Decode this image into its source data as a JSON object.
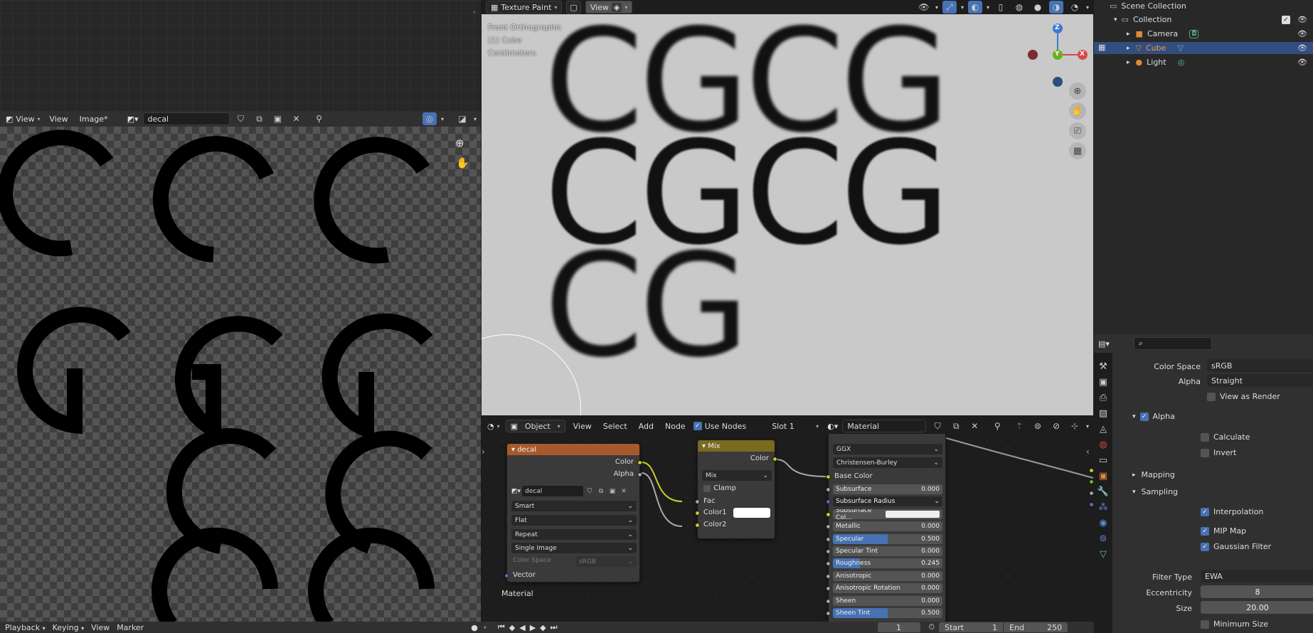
{
  "image_editor": {
    "view_mode": "View",
    "menus": [
      "View",
      "Image*"
    ],
    "image_name": "decal"
  },
  "viewport": {
    "mode": "Texture Paint",
    "view_btn": "View",
    "overlay_lines": [
      "Front Orthographic",
      "(1) Cube",
      "Centimeters"
    ],
    "texture_text": [
      "CGCG",
      "CGCG",
      "CG"
    ],
    "gizmo": {
      "z": "Z",
      "y": "Y",
      "x": "X"
    }
  },
  "outliner": {
    "root": "Scene Collection",
    "collection": "Collection",
    "items": [
      {
        "label": "Camera",
        "selected": false
      },
      {
        "label": "Cube",
        "selected": true
      },
      {
        "label": "Light",
        "selected": false
      }
    ]
  },
  "node_editor": {
    "mode": "Object",
    "menus": [
      "View",
      "Select",
      "Add",
      "Node"
    ],
    "use_nodes": "Use Nodes",
    "slot": "Slot 1",
    "material": "Material",
    "footer_label": "Material",
    "decal_node": {
      "title": "decal",
      "out_color": "Color",
      "out_alpha": "Alpha",
      "image": "decal",
      "interp": "Smart",
      "proj": "Flat",
      "ext": "Repeat",
      "source": "Single Image",
      "cs_label": "Color Space",
      "cs_value": "sRGB",
      "vector": "Vector"
    },
    "mix_node": {
      "title": "Mix",
      "out_color": "Color",
      "blend": "Mix",
      "clamp": "Clamp",
      "fac": "Fac",
      "color1": "Color1",
      "color2": "Color2"
    },
    "bsdf": {
      "dist": "GGX",
      "sss": "Christensen-Burley",
      "base_color": "Base Color",
      "rows": [
        {
          "label": "Subsurface",
          "value": "0.000",
          "fill": 0
        },
        {
          "label": "Subsurface Radius",
          "value": "",
          "fill": -1
        },
        {
          "label": "Subsurface Col...",
          "value": "",
          "fill": -2
        },
        {
          "label": "Metallic",
          "value": "0.000",
          "fill": 0
        },
        {
          "label": "Specular",
          "value": "0.500",
          "fill": 0.5
        },
        {
          "label": "Specular Tint",
          "value": "0.000",
          "fill": 0
        },
        {
          "label": "Roughness",
          "value": "0.245",
          "fill": 0.245
        },
        {
          "label": "Anisotropic",
          "value": "0.000",
          "fill": 0
        },
        {
          "label": "Anisotropic Rotation",
          "value": "0.000",
          "fill": 0
        },
        {
          "label": "Sheen",
          "value": "0.000",
          "fill": 0
        },
        {
          "label": "Sheen Tint",
          "value": "0.500",
          "fill": 0.5
        }
      ]
    }
  },
  "properties": {
    "color_space_label": "Color Space",
    "color_space": "sRGB",
    "alpha_label": "Alpha",
    "alpha_value": "Straight",
    "view_as_render": "View as Render",
    "alpha_panel": "Alpha",
    "calculate": "Calculate",
    "invert": "Invert",
    "mapping": "Mapping",
    "sampling": "Sampling",
    "interpolation": "Interpolation",
    "mip_map": "MIP Map",
    "gaussian": "Gaussian Filter",
    "filter_type_label": "Filter Type",
    "filter_type": "EWA",
    "eccentricity_label": "Eccentricity",
    "eccentricity": "8",
    "size_label": "Size",
    "size": "20.00",
    "min_size": "Minimum Size"
  },
  "timeline": {
    "menus": [
      "Playback",
      "Keying",
      "View",
      "Marker"
    ],
    "frame": "1",
    "start_label": "Start",
    "start": "1",
    "end_label": "End",
    "end": "250"
  },
  "colors": {
    "accent": "#4772b3",
    "image_node_header": "#a65a2b",
    "mix_node_header": "#7a6a1e",
    "selected_text": "#f0a03a",
    "viewport_bg": "#c9c9c9"
  }
}
